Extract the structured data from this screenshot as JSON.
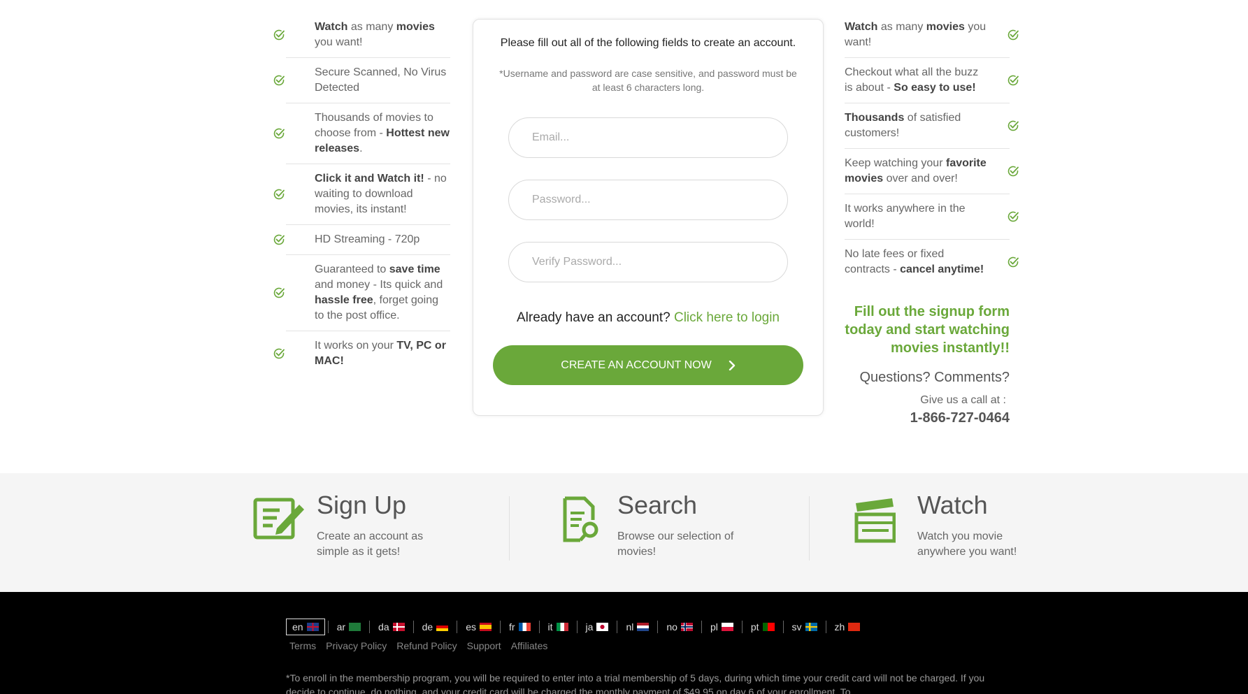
{
  "left_features": [
    {
      "parts": [
        {
          "t": "Watch",
          "b": true
        },
        {
          "t": " as many ",
          "b": false
        },
        {
          "t": "movies",
          "b": true
        },
        {
          "t": " you want!",
          "b": false
        }
      ]
    },
    {
      "parts": [
        {
          "t": "Secure Scanned, No Virus Detected",
          "b": false
        }
      ]
    },
    {
      "parts": [
        {
          "t": "Thousands of movies to choose from - ",
          "b": false
        },
        {
          "t": "Hottest new releases",
          "b": true
        },
        {
          "t": ".",
          "b": false
        }
      ]
    },
    {
      "parts": [
        {
          "t": "Click it and Watch it!",
          "b": true
        },
        {
          "t": " - no waiting to download movies, its instant!",
          "b": false
        }
      ]
    },
    {
      "parts": [
        {
          "t": "HD Streaming - 720p",
          "b": false
        }
      ]
    },
    {
      "parts": [
        {
          "t": "Guaranteed to ",
          "b": false
        },
        {
          "t": "save time",
          "b": true
        },
        {
          "t": " and money - Its quick and ",
          "b": false
        },
        {
          "t": "hassle free",
          "b": true
        },
        {
          "t": ", forget going to the post office.",
          "b": false
        }
      ]
    },
    {
      "parts": [
        {
          "t": "It works on your ",
          "b": false
        },
        {
          "t": "TV, PC or MAC!",
          "b": true
        }
      ]
    }
  ],
  "right_features": [
    {
      "parts": [
        {
          "t": "Watch",
          "b": true
        },
        {
          "t": " as many ",
          "b": false
        },
        {
          "t": "movies",
          "b": true
        },
        {
          "t": " you want!",
          "b": false
        }
      ]
    },
    {
      "parts": [
        {
          "t": "Checkout what all the buzz is about - ",
          "b": false
        },
        {
          "t": "So easy to use!",
          "b": true
        }
      ]
    },
    {
      "parts": [
        {
          "t": "Thousands",
          "b": true
        },
        {
          "t": " of satisfied customers!",
          "b": false
        }
      ]
    },
    {
      "parts": [
        {
          "t": "Keep watching your ",
          "b": false
        },
        {
          "t": "favorite movies",
          "b": true
        },
        {
          "t": " over and over!",
          "b": false
        }
      ]
    },
    {
      "parts": [
        {
          "t": "It works anywhere in the world!",
          "b": false
        }
      ]
    },
    {
      "parts": [
        {
          "t": "No late fees or fixed contracts - ",
          "b": false
        },
        {
          "t": "cancel anytime!",
          "b": true
        }
      ]
    }
  ],
  "form": {
    "title": "Please fill out all of the following fields to create an account.",
    "note": "*Username and password are case sensitive, and password must be at least 6 characters long.",
    "email_placeholder": "Email...",
    "password_placeholder": "Password...",
    "verify_placeholder": "Verify Password...",
    "login_prompt": "Already have an account?",
    "login_link": "Click here to login",
    "submit_label": "CREATE AN ACCOUNT NOW"
  },
  "sidebar": {
    "promo": "Fill out the signup form today and start watching movies instantly!!",
    "questions": "Questions? Comments?",
    "call_label": "Give us a call at :",
    "phone": "1-866-727-0464"
  },
  "steps": [
    {
      "icon": "signup-icon",
      "title": "Sign Up",
      "desc": "Create an account as simple as it gets!"
    },
    {
      "icon": "search-document-icon",
      "title": "Search",
      "desc": "Browse our selection of movies!"
    },
    {
      "icon": "clapperboard-icon",
      "title": "Watch",
      "desc": "Watch you movie anywhere you want!"
    }
  ],
  "footer": {
    "languages": [
      {
        "code": "en",
        "active": true
      },
      {
        "code": "ar",
        "active": false
      },
      {
        "code": "da",
        "active": false
      },
      {
        "code": "de",
        "active": false
      },
      {
        "code": "es",
        "active": false
      },
      {
        "code": "fr",
        "active": false
      },
      {
        "code": "it",
        "active": false
      },
      {
        "code": "ja",
        "active": false
      },
      {
        "code": "nl",
        "active": false
      },
      {
        "code": "no",
        "active": false
      },
      {
        "code": "pl",
        "active": false
      },
      {
        "code": "pt",
        "active": false
      },
      {
        "code": "sv",
        "active": false
      },
      {
        "code": "zh",
        "active": false
      }
    ],
    "links": [
      "Terms",
      "Privacy Policy",
      "Refund Policy",
      "Support",
      "Affiliates"
    ],
    "disclaimer": "*To enroll in the membership program, you will be required to enter into a trial membership of 5 days, during which time your credit card will not be charged. If you decide to continue, do nothing, and your credit card will be charged the monthly payment of $49.95 on day 6 of your enrollment. To"
  },
  "colors": {
    "accent_green": "#6aa83a",
    "footer_bg": "#000000",
    "steps_bg": "#f5f5f5"
  }
}
